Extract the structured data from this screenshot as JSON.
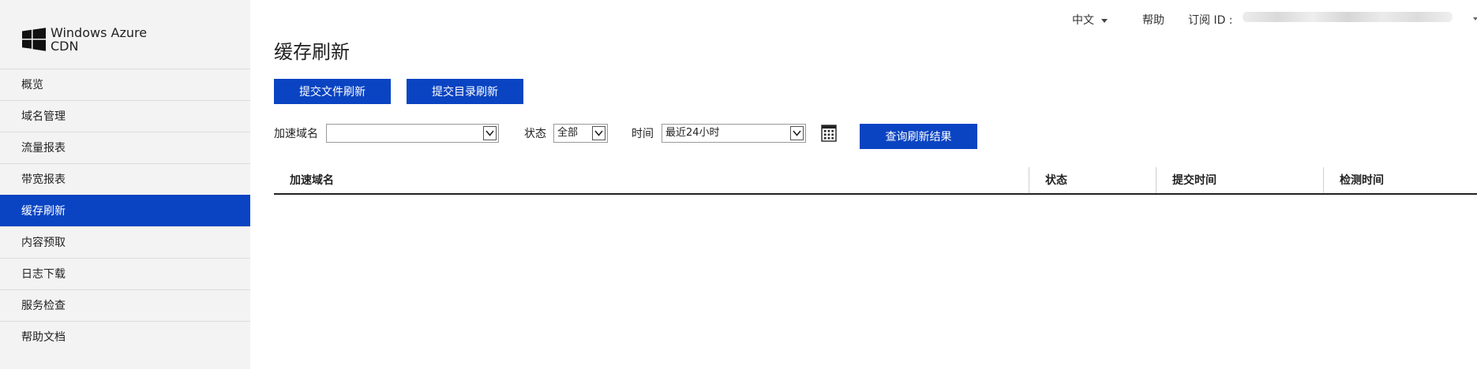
{
  "brand": {
    "line1": "Windows Azure",
    "line2": "CDN"
  },
  "sidebar": {
    "items": [
      {
        "label": "概览"
      },
      {
        "label": "域名管理"
      },
      {
        "label": "流量报表"
      },
      {
        "label": "带宽报表"
      },
      {
        "label": "缓存刷新",
        "active": true
      },
      {
        "label": "内容预取"
      },
      {
        "label": "日志下载"
      },
      {
        "label": "服务检查"
      },
      {
        "label": "帮助文档"
      }
    ]
  },
  "topbar": {
    "language": "中文",
    "help": "帮助",
    "subscription_label": "订阅 ID :"
  },
  "page": {
    "title": "缓存刷新"
  },
  "actions": {
    "submit_file_refresh": "提交文件刷新",
    "submit_dir_refresh": "提交目录刷新",
    "query_refresh_results": "查询刷新结果"
  },
  "filters": {
    "domain_label": "加速域名",
    "domain_value": "",
    "status_label": "状态",
    "status_value": "全部",
    "time_label": "时间",
    "time_value": "最近24小时"
  },
  "table": {
    "columns": [
      "加速域名",
      "状态",
      "提交时间",
      "检测时间"
    ],
    "rows": []
  },
  "colors": {
    "accent": "#0a44c2",
    "sidebar_bg": "#f3f3f3"
  }
}
